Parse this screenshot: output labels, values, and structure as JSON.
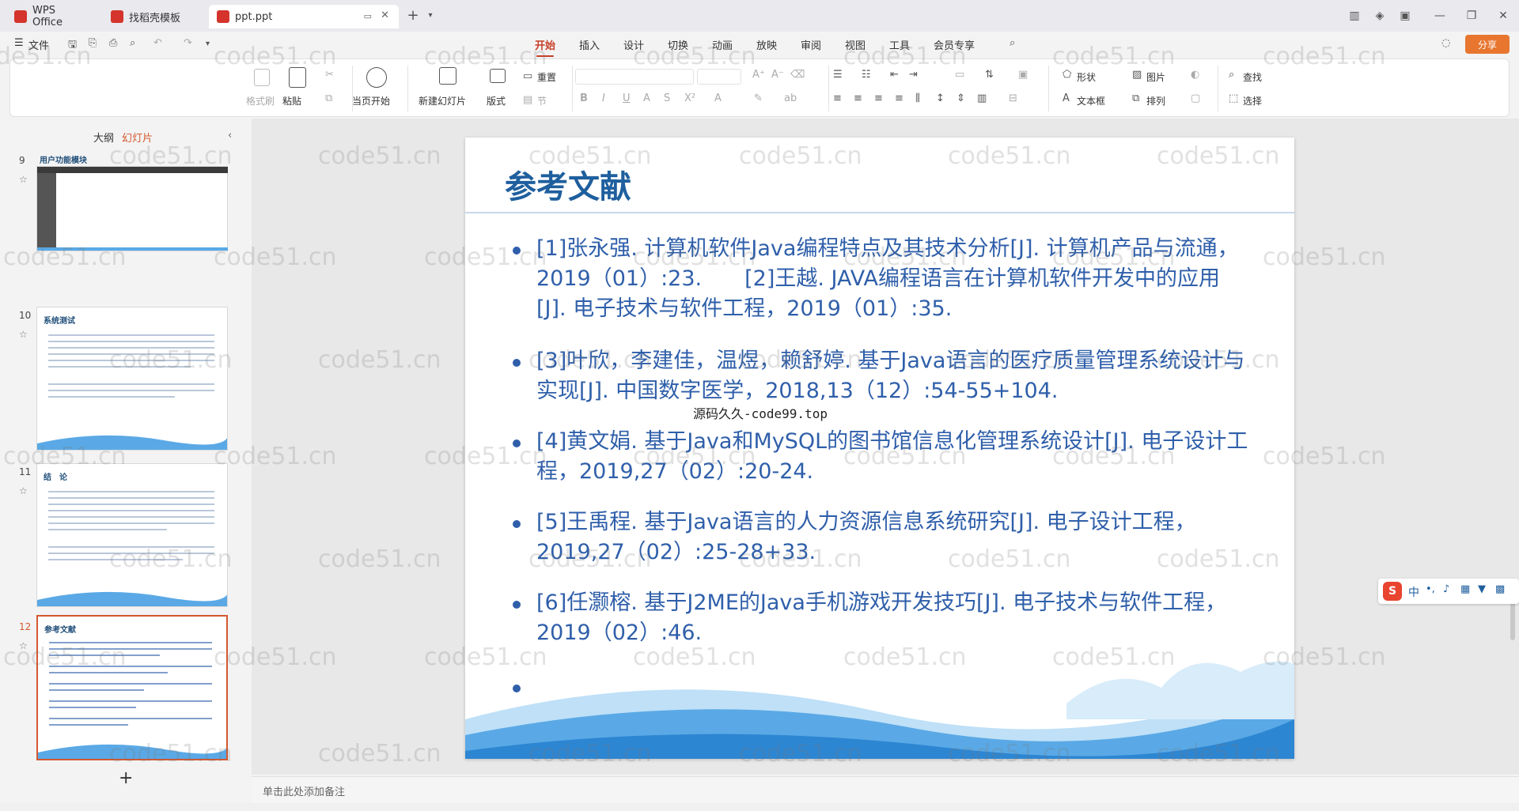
{
  "tabs": [
    {
      "label": "WPS Office",
      "icon": "wps-logo-icon",
      "color": "#d4342c"
    },
    {
      "label": "找稻壳模板",
      "icon": "docer-icon",
      "color": "#d4342c"
    },
    {
      "label": "ppt.ppt",
      "icon": "ppt-file-icon",
      "color": "#d4342c"
    }
  ],
  "menu": {
    "file": "文件",
    "items": [
      "开始",
      "插入",
      "设计",
      "切换",
      "动画",
      "放映",
      "审阅",
      "视图",
      "工具",
      "会员专享"
    ],
    "active": "开始",
    "share": "分享"
  },
  "ribbon": {
    "format_painter": "格式刷",
    "paste": "粘贴",
    "play_from_current": "当页开始",
    "new_slide": "新建幻灯片",
    "layout": "版式",
    "reset": "重置",
    "section": "节",
    "shape": "形状",
    "picture": "图片",
    "textbox": "文本框",
    "arrange": "排列",
    "find": "查找",
    "select": "选择"
  },
  "left_panel": {
    "tab_outline": "大纲",
    "tab_slides": "幻灯片",
    "slides": [
      {
        "number": "9",
        "title": "用户功能模块"
      },
      {
        "number": "10",
        "title": "系统测试"
      },
      {
        "number": "11",
        "title": "结　论"
      },
      {
        "number": "12",
        "title": "参考文献"
      }
    ],
    "add": "+"
  },
  "slide": {
    "title": "参考文献",
    "references": [
      "[1]张永强. 计算机软件Java编程特点及其技术分析[J]. 计算机产品与流通，2019（01）:23.　　[2]王越. JAVA编程语言在计算机软件开发中的应用[J]. 电子技术与软件工程，2019（01）:35.",
      "[3]叶欣，李建佳，温煜，赖舒婷. 基于Java语言的医疗质量管理系统设计与实现[J]. 中国数字医学，2018,13（12）:54-55+104.",
      "[4]黄文娟. 基于Java和MySQL的图书馆信息化管理系统设计[J]. 电子设计工程，2019,27（02）:20-24.",
      "[5]王禹程. 基于Java语言的人力资源信息系统研究[J]. 电子设计工程，2019,27（02）:25-28+33.",
      "[6]任灏榕. 基于J2ME的Java手机游戏开发技巧[J]. 电子技术与软件工程，2019（02）:46."
    ],
    "overlay_caption": "源码久久-code99.top"
  },
  "notes_placeholder": "单击此处添加备注",
  "watermark": "code51.cn",
  "ime": {
    "label": "中"
  },
  "colors": {
    "accent": "#c7402a",
    "slide_text": "#2f5faa",
    "slide_title": "#1f5f9e",
    "selected_thumb": "#d4582f"
  }
}
